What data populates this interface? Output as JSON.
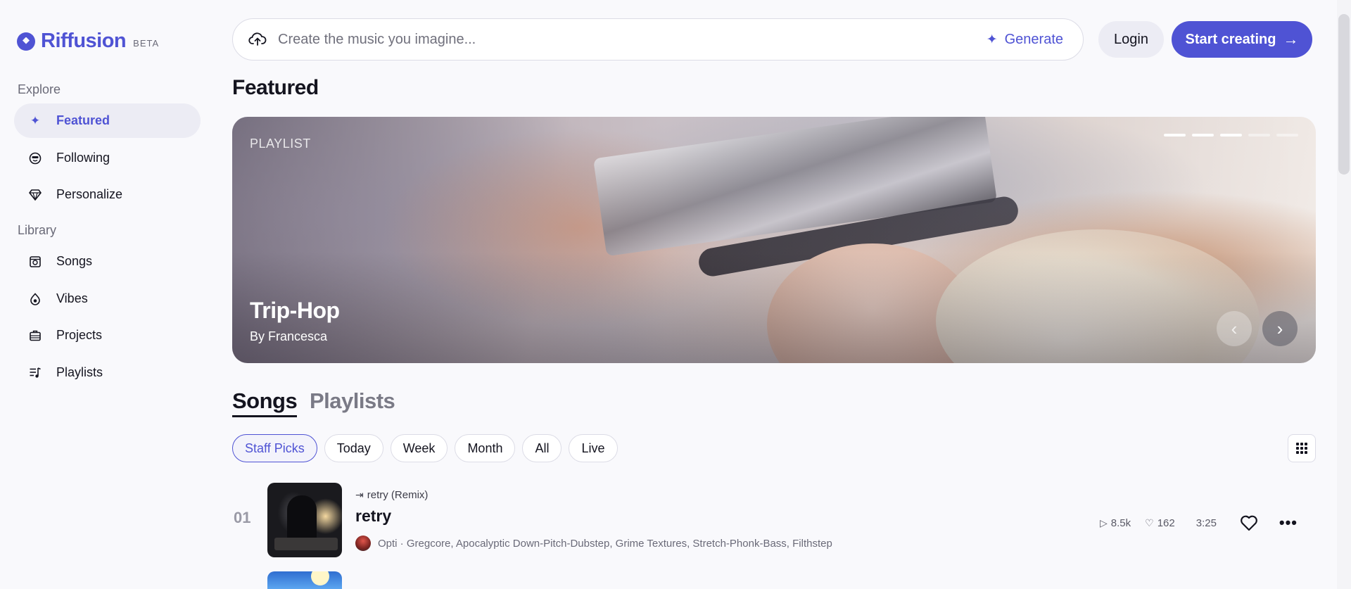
{
  "brand": {
    "name": "Riffusion",
    "badge": "BETA",
    "accent": "#4f53d4"
  },
  "sidebar": {
    "explore_heading": "Explore",
    "explore_items": [
      {
        "label": "Featured",
        "icon": "sparkle-icon",
        "active": true
      },
      {
        "label": "Following",
        "icon": "smiley-icon",
        "active": false
      },
      {
        "label": "Personalize",
        "icon": "diamond-icon",
        "active": false
      }
    ],
    "library_heading": "Library",
    "library_items": [
      {
        "label": "Songs",
        "icon": "music-box-icon"
      },
      {
        "label": "Vibes",
        "icon": "vibe-drop-icon"
      },
      {
        "label": "Projects",
        "icon": "folder-case-icon"
      },
      {
        "label": "Playlists",
        "icon": "playlist-icon"
      }
    ]
  },
  "topbar": {
    "search_placeholder": "Create the music you imagine...",
    "search_value": "",
    "generate_label": "Generate",
    "login_label": "Login",
    "start_label": "Start creating"
  },
  "featured": {
    "title": "Featured",
    "hero": {
      "kicker": "PLAYLIST",
      "title": "Trip-Hop",
      "byline": "By Francesca",
      "slide_count": 5,
      "active_slides": 3
    }
  },
  "content_tabs": [
    {
      "label": "Songs",
      "active": true
    },
    {
      "label": "Playlists",
      "active": false
    }
  ],
  "filters": [
    {
      "label": "Staff Picks",
      "active": true
    },
    {
      "label": "Today",
      "active": false
    },
    {
      "label": "Week",
      "active": false
    },
    {
      "label": "Month",
      "active": false
    },
    {
      "label": "All",
      "active": false
    },
    {
      "label": "Live",
      "active": false
    }
  ],
  "songs": [
    {
      "rank": "01",
      "remix_of": "retry (Remix)",
      "title": "retry",
      "artist": "Opti",
      "tags": "Gregcore, Apocalyptic Down-Pitch-Dubstep, Grime Textures, Stretch-Phonk-Bass, Filthstep",
      "plays": "8.5k",
      "likes": "162",
      "duration": "3:25"
    }
  ]
}
